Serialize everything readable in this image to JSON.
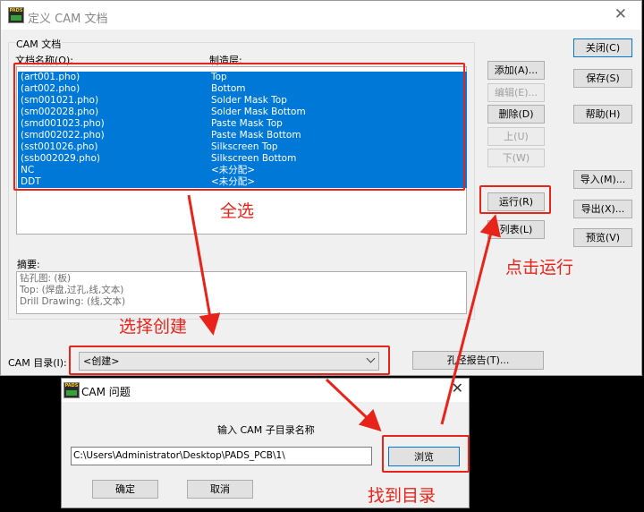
{
  "main_window": {
    "title": "定义 CAM 文档",
    "app_icon": "PADS",
    "group_label": "CAM 文档",
    "col_name_header": "文档名称(O):",
    "col_layer_header": "制造层:",
    "documents": [
      {
        "name": "(art001.pho)",
        "layer": "Top"
      },
      {
        "name": "(art002.pho)",
        "layer": "Bottom"
      },
      {
        "name": "(sm001021.pho)",
        "layer": "Solder Mask Top"
      },
      {
        "name": "(sm002028.pho)",
        "layer": "Solder Mask Bottom"
      },
      {
        "name": "(smd001023.pho)",
        "layer": "Paste Mask Top"
      },
      {
        "name": "(smd002022.pho)",
        "layer": "Paste Mask Bottom"
      },
      {
        "name": "(sst001026.pho)",
        "layer": "Silkscreen Top"
      },
      {
        "name": "(ssb002029.pho)",
        "layer": "Silkscreen Bottom"
      },
      {
        "name": "NC",
        "layer": "<未分配>"
      },
      {
        "name": "DDT",
        "layer": "<未分配>"
      }
    ],
    "summary_label": "摘要:",
    "summary_lines": [
      "钻孔图: (板)",
      "Top: (焊盘,过孔,线,文本)",
      "Drill Drawing: (线,文本)"
    ],
    "buttons": {
      "add": "添加(A)...",
      "edit": "编辑(E)...",
      "delete": "删除(D)",
      "up": "上(U)",
      "down": "下(W)",
      "run": "运行(R)",
      "list": "列表(L)",
      "close": "关闭(C)",
      "save": "保存(S)",
      "help": "帮助(H)",
      "import": "导入(M)...",
      "export": "导出(X)...",
      "preview": "预览(V)",
      "drill_report": "孔径报告(T)..."
    },
    "cam_dir_label": "CAM 目录(I):",
    "cam_dir_value": "<创建>"
  },
  "dialog": {
    "title": "CAM 问题",
    "prompt": "输入 CAM 子目录名称",
    "path_value": "C:\\Users\\Administrator\\Desktop\\PADS_PCB\\1\\",
    "browse": "浏览",
    "ok": "确定",
    "cancel": "取消"
  },
  "annotations": {
    "select_all": "全选",
    "click_run": "点击运行",
    "select_create": "选择创建",
    "find_dir": "找到目录",
    "color": "#e8241a"
  }
}
